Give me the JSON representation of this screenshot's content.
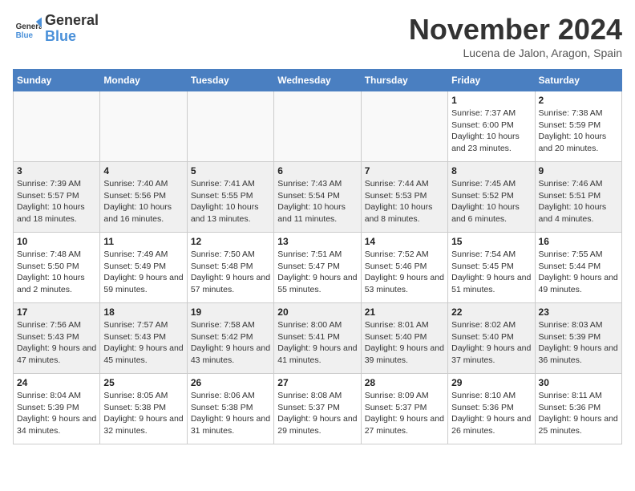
{
  "logo": {
    "general": "General",
    "blue": "Blue"
  },
  "header": {
    "month": "November 2024",
    "location": "Lucena de Jalon, Aragon, Spain"
  },
  "weekdays": [
    "Sunday",
    "Monday",
    "Tuesday",
    "Wednesday",
    "Thursday",
    "Friday",
    "Saturday"
  ],
  "weeks": [
    [
      {
        "day": "",
        "info": ""
      },
      {
        "day": "",
        "info": ""
      },
      {
        "day": "",
        "info": ""
      },
      {
        "day": "",
        "info": ""
      },
      {
        "day": "",
        "info": ""
      },
      {
        "day": "1",
        "info": "Sunrise: 7:37 AM\nSunset: 6:00 PM\nDaylight: 10 hours and 23 minutes."
      },
      {
        "day": "2",
        "info": "Sunrise: 7:38 AM\nSunset: 5:59 PM\nDaylight: 10 hours and 20 minutes."
      }
    ],
    [
      {
        "day": "3",
        "info": "Sunrise: 7:39 AM\nSunset: 5:57 PM\nDaylight: 10 hours and 18 minutes."
      },
      {
        "day": "4",
        "info": "Sunrise: 7:40 AM\nSunset: 5:56 PM\nDaylight: 10 hours and 16 minutes."
      },
      {
        "day": "5",
        "info": "Sunrise: 7:41 AM\nSunset: 5:55 PM\nDaylight: 10 hours and 13 minutes."
      },
      {
        "day": "6",
        "info": "Sunrise: 7:43 AM\nSunset: 5:54 PM\nDaylight: 10 hours and 11 minutes."
      },
      {
        "day": "7",
        "info": "Sunrise: 7:44 AM\nSunset: 5:53 PM\nDaylight: 10 hours and 8 minutes."
      },
      {
        "day": "8",
        "info": "Sunrise: 7:45 AM\nSunset: 5:52 PM\nDaylight: 10 hours and 6 minutes."
      },
      {
        "day": "9",
        "info": "Sunrise: 7:46 AM\nSunset: 5:51 PM\nDaylight: 10 hours and 4 minutes."
      }
    ],
    [
      {
        "day": "10",
        "info": "Sunrise: 7:48 AM\nSunset: 5:50 PM\nDaylight: 10 hours and 2 minutes."
      },
      {
        "day": "11",
        "info": "Sunrise: 7:49 AM\nSunset: 5:49 PM\nDaylight: 9 hours and 59 minutes."
      },
      {
        "day": "12",
        "info": "Sunrise: 7:50 AM\nSunset: 5:48 PM\nDaylight: 9 hours and 57 minutes."
      },
      {
        "day": "13",
        "info": "Sunrise: 7:51 AM\nSunset: 5:47 PM\nDaylight: 9 hours and 55 minutes."
      },
      {
        "day": "14",
        "info": "Sunrise: 7:52 AM\nSunset: 5:46 PM\nDaylight: 9 hours and 53 minutes."
      },
      {
        "day": "15",
        "info": "Sunrise: 7:54 AM\nSunset: 5:45 PM\nDaylight: 9 hours and 51 minutes."
      },
      {
        "day": "16",
        "info": "Sunrise: 7:55 AM\nSunset: 5:44 PM\nDaylight: 9 hours and 49 minutes."
      }
    ],
    [
      {
        "day": "17",
        "info": "Sunrise: 7:56 AM\nSunset: 5:43 PM\nDaylight: 9 hours and 47 minutes."
      },
      {
        "day": "18",
        "info": "Sunrise: 7:57 AM\nSunset: 5:43 PM\nDaylight: 9 hours and 45 minutes."
      },
      {
        "day": "19",
        "info": "Sunrise: 7:58 AM\nSunset: 5:42 PM\nDaylight: 9 hours and 43 minutes."
      },
      {
        "day": "20",
        "info": "Sunrise: 8:00 AM\nSunset: 5:41 PM\nDaylight: 9 hours and 41 minutes."
      },
      {
        "day": "21",
        "info": "Sunrise: 8:01 AM\nSunset: 5:40 PM\nDaylight: 9 hours and 39 minutes."
      },
      {
        "day": "22",
        "info": "Sunrise: 8:02 AM\nSunset: 5:40 PM\nDaylight: 9 hours and 37 minutes."
      },
      {
        "day": "23",
        "info": "Sunrise: 8:03 AM\nSunset: 5:39 PM\nDaylight: 9 hours and 36 minutes."
      }
    ],
    [
      {
        "day": "24",
        "info": "Sunrise: 8:04 AM\nSunset: 5:39 PM\nDaylight: 9 hours and 34 minutes."
      },
      {
        "day": "25",
        "info": "Sunrise: 8:05 AM\nSunset: 5:38 PM\nDaylight: 9 hours and 32 minutes."
      },
      {
        "day": "26",
        "info": "Sunrise: 8:06 AM\nSunset: 5:38 PM\nDaylight: 9 hours and 31 minutes."
      },
      {
        "day": "27",
        "info": "Sunrise: 8:08 AM\nSunset: 5:37 PM\nDaylight: 9 hours and 29 minutes."
      },
      {
        "day": "28",
        "info": "Sunrise: 8:09 AM\nSunset: 5:37 PM\nDaylight: 9 hours and 27 minutes."
      },
      {
        "day": "29",
        "info": "Sunrise: 8:10 AM\nSunset: 5:36 PM\nDaylight: 9 hours and 26 minutes."
      },
      {
        "day": "30",
        "info": "Sunrise: 8:11 AM\nSunset: 5:36 PM\nDaylight: 9 hours and 25 minutes."
      }
    ]
  ]
}
